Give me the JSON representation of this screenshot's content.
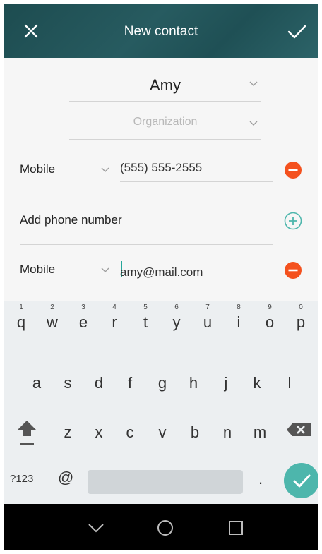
{
  "header": {
    "title": "New contact",
    "close_icon": "close-icon",
    "confirm_icon": "check-icon",
    "background": "#1f5055"
  },
  "form": {
    "name_value": "Amy",
    "organization_placeholder": "Organization",
    "phone": {
      "type": "Mobile",
      "value": "(555) 555-2555"
    },
    "add_phone_label": "Add phone number",
    "email": {
      "type": "Mobile",
      "value": "amy@mail.com"
    },
    "remove_color": "#f4511e",
    "add_color": "#4db6ac"
  },
  "keyboard": {
    "row1": [
      {
        "ch": "q",
        "num": "1"
      },
      {
        "ch": "w",
        "num": "2"
      },
      {
        "ch": "e",
        "num": "3"
      },
      {
        "ch": "r",
        "num": "4"
      },
      {
        "ch": "t",
        "num": "5"
      },
      {
        "ch": "y",
        "num": "6"
      },
      {
        "ch": "u",
        "num": "7"
      },
      {
        "ch": "i",
        "num": "8"
      },
      {
        "ch": "o",
        "num": "9"
      },
      {
        "ch": "p",
        "num": "0"
      }
    ],
    "row2": [
      "a",
      "s",
      "d",
      "f",
      "g",
      "h",
      "j",
      "k",
      "l"
    ],
    "row3": [
      "z",
      "x",
      "c",
      "v",
      "b",
      "n",
      "m"
    ],
    "symbols_label": "?123",
    "at_label": "@",
    "period_label": ".",
    "enter_color": "#4db6ac"
  },
  "navbar": {
    "back_icon": "back-icon",
    "home_icon": "home-icon",
    "recents_icon": "recents-icon"
  }
}
